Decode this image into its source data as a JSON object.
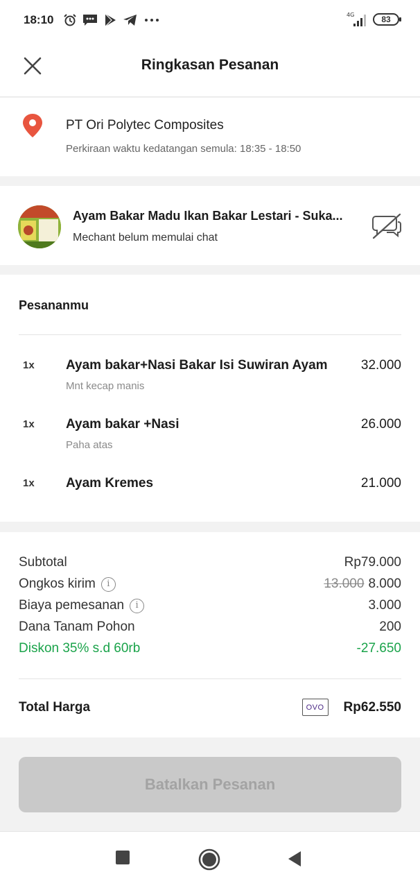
{
  "status_bar": {
    "time": "18:10",
    "network": "4G",
    "battery": "83"
  },
  "header": {
    "title": "Ringkasan Pesanan",
    "close_icon": "close-icon"
  },
  "address": {
    "name": "PT Ori Polytec Composites",
    "eta": "Perkiraan waktu kedatangan semula: 18:35 - 18:50",
    "icon": "location-pin-icon",
    "color": "#e8553f"
  },
  "merchant": {
    "name": "Ayam Bakar Madu Ikan Bakar Lestari - Suka...",
    "status": "Mechant belum memulai chat",
    "chat_icon": "chat-disabled-icon"
  },
  "orders": {
    "title": "Pesananmu",
    "items": [
      {
        "qty": "1x",
        "name": "Ayam bakar+Nasi Bakar Isi Suwiran Ayam",
        "note": "Mnt kecap manis",
        "price": "32.000"
      },
      {
        "qty": "1x",
        "name": "Ayam bakar +Nasi",
        "note": "Paha atas",
        "price": "26.000"
      },
      {
        "qty": "1x",
        "name": "Ayam Kremes",
        "note": "",
        "price": "21.000"
      }
    ]
  },
  "summary": {
    "subtotal_label": "Subtotal",
    "subtotal_value": "Rp79.000",
    "delivery_label": "Ongkos kirim",
    "delivery_old": "13.000",
    "delivery_value": "8.000",
    "order_fee_label": "Biaya pemesanan",
    "order_fee_value": "3.000",
    "tree_label": "Dana Tanam Pohon",
    "tree_value": "200",
    "discount_label": "Diskon 35% s.d 60rb",
    "discount_value": "-27.650",
    "discount_color": "#1aa34a",
    "total_label": "Total Harga",
    "payment_badge": "OVO",
    "total_value": "Rp62.550"
  },
  "actions": {
    "cancel_label": "Batalkan Pesanan"
  },
  "nav": {
    "recents_icon": "square-icon",
    "home_icon": "circle-icon",
    "back_icon": "back-triangle-icon"
  }
}
